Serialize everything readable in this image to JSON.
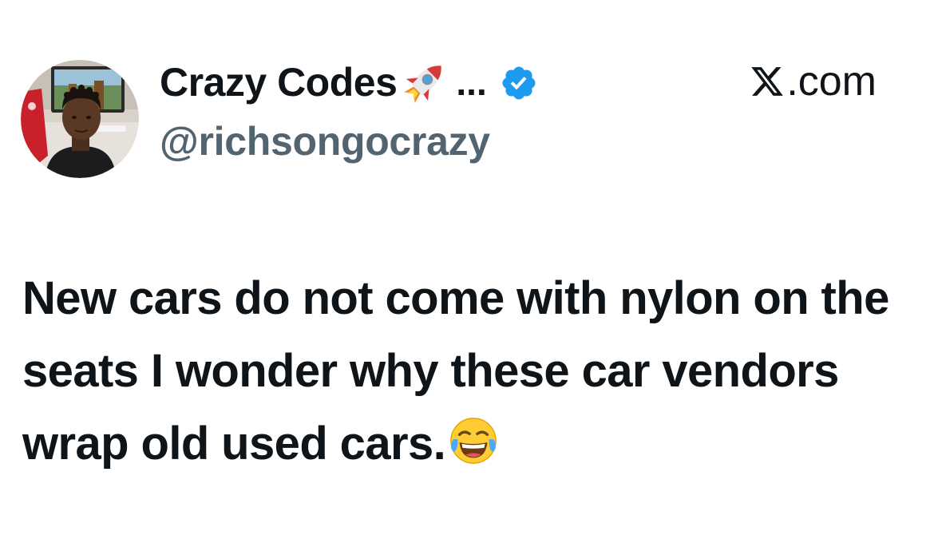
{
  "author": {
    "display_name": "Crazy Codes",
    "name_emoji_icon": "rocket-icon",
    "name_truncation": "...",
    "verified": true,
    "verified_icon": "verified-badge-icon",
    "handle": "@richsongocrazy",
    "avatar_icon": "avatar-photo"
  },
  "source": {
    "logo_icon": "x-logo-icon",
    "label": ".com"
  },
  "tweet": {
    "text": "New cars do not come with nylon on the seats I wonder why these car vendors wrap old used cars.",
    "trailing_emoji_icon": "face-with-tears-of-joy-icon"
  },
  "colors": {
    "text_primary": "#0f1419",
    "text_secondary": "#536471",
    "verified_blue": "#1d9bf0",
    "background": "#ffffff"
  }
}
